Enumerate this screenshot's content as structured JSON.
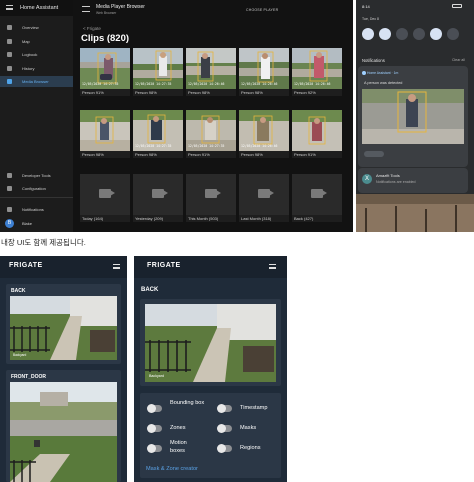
{
  "home_assistant": {
    "app_title": "Home Assistant",
    "nav": [
      {
        "label": "Overview",
        "icon": "dashboard-icon"
      },
      {
        "label": "Map",
        "icon": "map-icon"
      },
      {
        "label": "Logbook",
        "icon": "list-icon"
      },
      {
        "label": "History",
        "icon": "chart-icon"
      },
      {
        "label": "Media Browser",
        "icon": "media-icon",
        "active": true
      }
    ],
    "nav_bottom": [
      {
        "label": "Developer Tools",
        "icon": "wrench-icon"
      },
      {
        "label": "Configuration",
        "icon": "gear-icon"
      },
      {
        "label": "Notifications",
        "icon": "bell-icon"
      },
      {
        "label": "Blake",
        "icon": "user-avatar-icon"
      }
    ],
    "avatar_initial": "B",
    "media_title": "Media Player Browser",
    "media_subtitle": "Web Browser",
    "choose_player": "CHOOSE PLAYER",
    "breadcrumb": "< Frigate",
    "heading": "Clips (820)",
    "clips": [
      {
        "label": "Person 91%",
        "ts": "12/05/2020 14:27:35"
      },
      {
        "label": "Person 98%",
        "ts": "12/05/2020 14:27:35"
      },
      {
        "label": "Person 98%",
        "ts": "12/05/2020 14:26:46"
      },
      {
        "label": "Person 98%",
        "ts": "12/05/2020 14:26:46"
      },
      {
        "label": "Person 92%",
        "ts": "12/05/2020 14:26:46"
      },
      {
        "label": "Person 98%",
        "ts": ""
      },
      {
        "label": "Person 98%",
        "ts": "12/05/2020 14:27:35"
      },
      {
        "label": "Person 91%",
        "ts": "12/05/2020 14:27:35"
      },
      {
        "label": "Person 98%",
        "ts": "12/05/2020 14:26:46"
      },
      {
        "label": "Person 91%",
        "ts": ""
      }
    ],
    "folders": [
      "Today (164)",
      "Yesterday (209)",
      "This Month (503)",
      "Last Month (318)",
      "Back (427)"
    ]
  },
  "phone": {
    "time": "8:14",
    "date": "Tue, Dec 8",
    "notifications_header": "Notifications",
    "clear_all": "Clear all",
    "card1_app": "Home Assistant · 1m",
    "card1_text": "A person was detected",
    "card2_title": "Amazfit Tools",
    "card2_sub": "Notifications are enabled",
    "card2_icon": "X"
  },
  "caption": "내장 UI도 함께 제공됩니다.",
  "frigate_left": {
    "brand": "FRIGATE",
    "cameras": [
      {
        "title": "BACK",
        "stamp": "Backyard"
      },
      {
        "title": "FRONT_DOOR",
        "stamp": ""
      }
    ]
  },
  "frigate_right": {
    "brand": "FRIGATE",
    "section": "BACK",
    "stamp": "Backyard",
    "toggles_left": [
      "Bounding box",
      "Zones",
      "Motion boxes"
    ],
    "toggles_right": [
      "Timestamp",
      "Masks",
      "Regions"
    ],
    "link": "Mask & Zone creator"
  }
}
